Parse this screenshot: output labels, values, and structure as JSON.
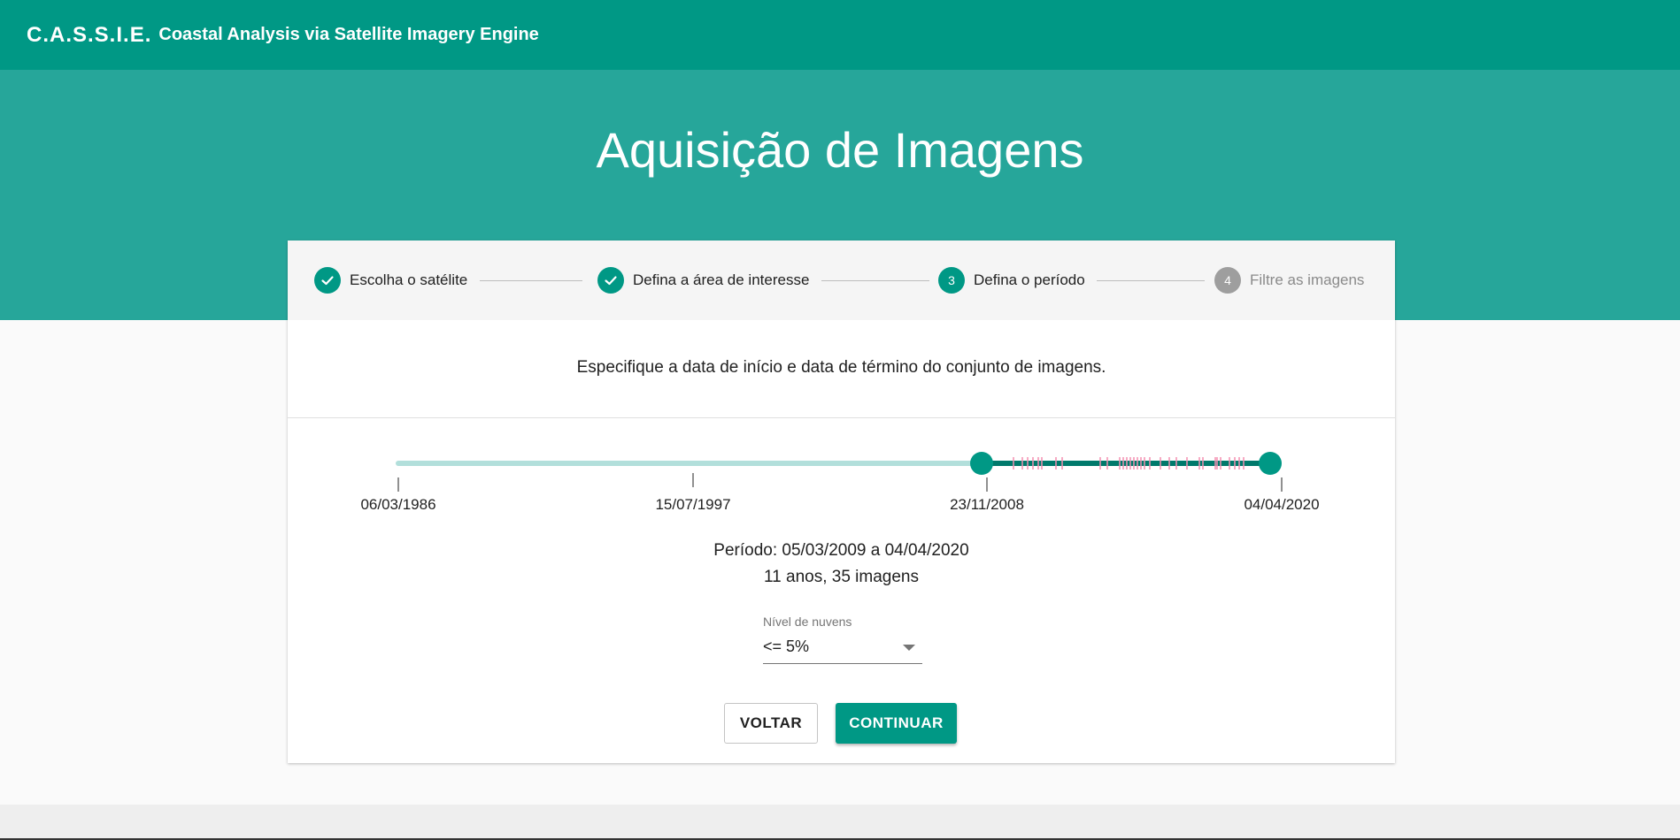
{
  "app": {
    "brand": "C.A.S.S.I.E.",
    "subtitle": "Coastal Analysis via Satellite Imagery Engine"
  },
  "page": {
    "title": "Aquisição de Imagens"
  },
  "stepper": {
    "steps": [
      {
        "number": "1",
        "label": "Escolha o satélite",
        "state": "done"
      },
      {
        "number": "2",
        "label": "Defina a área de interesse",
        "state": "done"
      },
      {
        "number": "3",
        "label": "Defina o período",
        "state": "active"
      },
      {
        "number": "4",
        "label": "Filtre as imagens",
        "state": "pending"
      }
    ]
  },
  "instruction": "Especifique a data de início e data de término do conjunto de imagens.",
  "timeline": {
    "ticks": [
      "06/03/1986",
      "15/07/1997",
      "23/11/2008",
      "04/04/2020"
    ],
    "range_min": "06/03/1986",
    "range_max": "04/04/2020",
    "selected_start": "05/03/2009",
    "selected_end": "04/04/2020"
  },
  "summary": {
    "period": "Período: 05/03/2009 a 04/04/2020",
    "stats": "11 anos, 35 imagens"
  },
  "cloud_filter": {
    "label": "Nível de nuvens",
    "value": "<= 5%"
  },
  "buttons": {
    "back": "VOLTAR",
    "continue": "CONTINUAR"
  },
  "colors": {
    "primary": "#009885",
    "hero": "#26a69a",
    "track_selected": "#00796b",
    "track_unselected": "#b2dfdb",
    "image_markers": "#f48fb1"
  }
}
